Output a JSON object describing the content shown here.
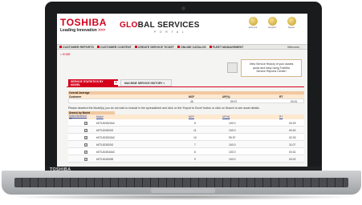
{
  "laptop": {
    "brand": "TOSHIBA"
  },
  "header": {
    "logo": "TOSHIBA",
    "tagline_prefix": "Leading Innovation",
    "tagline_mark": ">>>",
    "portal_global": "GL",
    "portal_o": "O",
    "portal_rest": "BAL SERVICES",
    "portal_sub": "P O R T A L",
    "icons": [
      {
        "name": "account-icon",
        "label": "account"
      },
      {
        "name": "support-icon",
        "label": "support"
      },
      {
        "name": "logout-icon",
        "label": "logout"
      }
    ]
  },
  "nav": {
    "items": [
      "CUSTOMER REPORTS",
      "CUSTOMER CONTENT",
      "CREATE SERVICE TICKET",
      "ONLINE CATALOG",
      "FLEET MANAGEMENT"
    ],
    "welcome": "Welcome ,"
  },
  "breadcrumb": {
    "home": "< HOME"
  },
  "info_box": {
    "line1": "View Service History of your assets",
    "line2": "quick and easy using Toshiba",
    "line3": "Service Reports Center!"
  },
  "tabs": {
    "active": "SERVICE STATISTICS BY MODEL",
    "active_marker": "▾",
    "inactive": "MACHINE SERVICE HISTORY >"
  },
  "overall": {
    "title": "Overall Average",
    "col_customer": "Customer",
    "col_mcf": "MCF",
    "col_uf": "UF(%)",
    "col_rt": "RT",
    "row": {
      "customer": "",
      "mcf": "45",
      "uf": "99.97",
      "rt": "00:31"
    }
  },
  "note": "Please deselect the Model(s) you do not wish to include in the spreadsheet and click on the 'Export to Excel' button or click on Search to see asset details.",
  "by_model": {
    "title": "Search by Model",
    "headers": {
      "select": "Select/Deselect All",
      "model": "Model",
      "mcf": "MCF",
      "uf": "UF(%)",
      "rt": "RT"
    },
    "rows": [
      {
        "model": "bSTUD3520AC",
        "mcf": "5",
        "uf": "100.0",
        "rt": "00:29"
      },
      {
        "model": "bSTUD3520G",
        "mcf": "11",
        "uf": "100.0",
        "rt": "00:00"
      },
      {
        "model": "bSTUD3520AC",
        "mcf": "10",
        "uf": "99.97",
        "rt": "02:03"
      },
      {
        "model": "bSTUD3520G",
        "mcf": "7",
        "uf": "100.0",
        "rt": "11:07"
      },
      {
        "model": "bSTUD3540AC",
        "mcf": "6",
        "uf": "100.0",
        "rt": "00:31"
      },
      {
        "model": "bSTUD4540B",
        "mcf": "9",
        "uf": "100.0",
        "rt": "00:02"
      }
    ]
  }
}
